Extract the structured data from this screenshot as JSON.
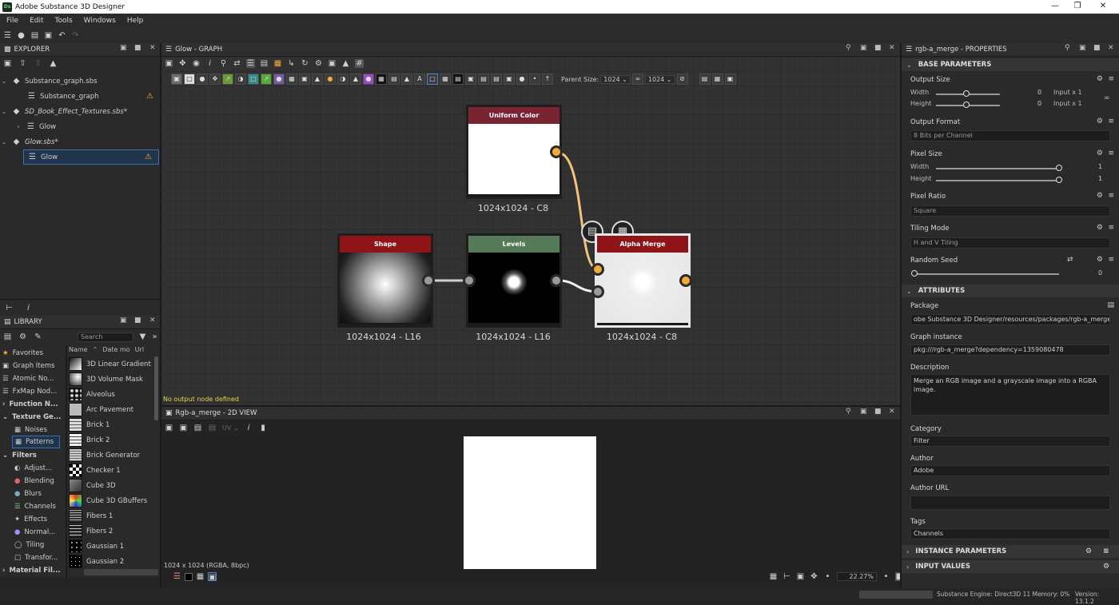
{
  "app": {
    "title": "Adobe Substance 3D Designer",
    "logo": "Ds"
  },
  "menu": [
    "File",
    "Edit",
    "Tools",
    "Windows",
    "Help"
  ],
  "explorer": {
    "title": "EXPLORER",
    "items": [
      {
        "label": "Substance_graph.sbs",
        "type": "package"
      },
      {
        "label": "Substance_graph",
        "type": "graph",
        "warning": true
      },
      {
        "label": "SD_Book_Effect_Textures.sbs*",
        "type": "package"
      },
      {
        "label": "Glow",
        "type": "folder"
      },
      {
        "label": "Glow.sbs*",
        "type": "package"
      },
      {
        "label": "Glow",
        "type": "graph",
        "warning": true,
        "selected": true
      }
    ]
  },
  "library": {
    "title": "LIBRARY",
    "search_placeholder": "Search",
    "columns": [
      "Name",
      "Date mo",
      "Url"
    ],
    "categories": [
      "Favorites",
      "Graph Items",
      "Atomic No...",
      "FxMap Nod...",
      "Function N...",
      "Texture Ge...",
      "Noises",
      "Patterns",
      "Filters",
      "Adjust...",
      "Blending",
      "Blurs",
      "Channels",
      "Effects",
      "Normal...",
      "Tiling",
      "Transfor...",
      "Material Fil..."
    ],
    "items": [
      "3D Linear Gradient",
      "3D Volume Mask",
      "Alveolus",
      "Arc Pavement",
      "Brick 1",
      "Brick 2",
      "Brick Generator",
      "Checker 1",
      "Cube 3D",
      "Cube 3D GBuffers",
      "Fibers 1",
      "Fibers 2",
      "Gaussian 1",
      "Gaussian 2"
    ]
  },
  "graph": {
    "title": "Glow - GRAPH",
    "parent_size_label": "Parent Size:",
    "width": "1024",
    "height": "1024",
    "warning": "No output node defined",
    "nodes": [
      {
        "name": "Uniform Color",
        "label": "1024x1024 - C8",
        "color": "#7a2431"
      },
      {
        "name": "Shape",
        "label": "1024x1024 - L16",
        "color": "#8e1418"
      },
      {
        "name": "Levels",
        "label": "1024x1024 - L16",
        "color": "#557a58"
      },
      {
        "name": "Alpha Merge",
        "label": "1024x1024 - C8",
        "color": "#8e1418"
      }
    ]
  },
  "view2d": {
    "title": "Rgb-a_merge - 2D VIEW",
    "uv": "UV",
    "info": "1024 x 1024 (RGBA, 8bpc)",
    "zoom": "22.27%"
  },
  "properties": {
    "title": "rgb-a_merge - PROPERTIES",
    "base_title": "BASE PARAMETERS",
    "output_size": {
      "label": "Output Size",
      "w_label": "Width",
      "h_label": "Height",
      "w_val": "0",
      "h_val": "0",
      "w_mode": "Input x 1",
      "h_mode": "Input x 1"
    },
    "output_format": {
      "label": "Output Format",
      "value": "8 Bits per Channel"
    },
    "pixel_size": {
      "label": "Pixel Size",
      "w_label": "Width",
      "h_label": "Height",
      "w_val": "1",
      "h_val": "1"
    },
    "pixel_ratio": {
      "label": "Pixel Ratio",
      "value": "Square"
    },
    "tiling_mode": {
      "label": "Tiling Mode",
      "value": "H and V Tiling"
    },
    "random_seed": {
      "label": "Random Seed",
      "value": "0"
    },
    "attributes_title": "ATTRIBUTES",
    "package": {
      "label": "Package",
      "value": "obe Substance 3D Designer/resources/packages/rgb-a_merge.sbs"
    },
    "graph_instance": {
      "label": "Graph instance",
      "value": "pkg:///rgb-a_merge?dependency=1359080478"
    },
    "description": {
      "label": "Description",
      "value": "Merge an RGB image and a grayscale image into a RGBA image."
    },
    "category": {
      "label": "Category",
      "value": "Filter"
    },
    "author": {
      "label": "Author",
      "value": "Adobe"
    },
    "author_url": {
      "label": "Author URL",
      "value": ""
    },
    "tags": {
      "label": "Tags",
      "value": "Channels"
    },
    "instance_title": "INSTANCE PARAMETERS",
    "input_title": "INPUT VALUES"
  },
  "status": {
    "engine": "Substance Engine: Direct3D 11  Memory: 0%",
    "version": "Version: 13.1.2"
  },
  "colors": {
    "accent": "#f2a93b",
    "selection": "#3b6fb0",
    "warning": "#f2b43a"
  }
}
